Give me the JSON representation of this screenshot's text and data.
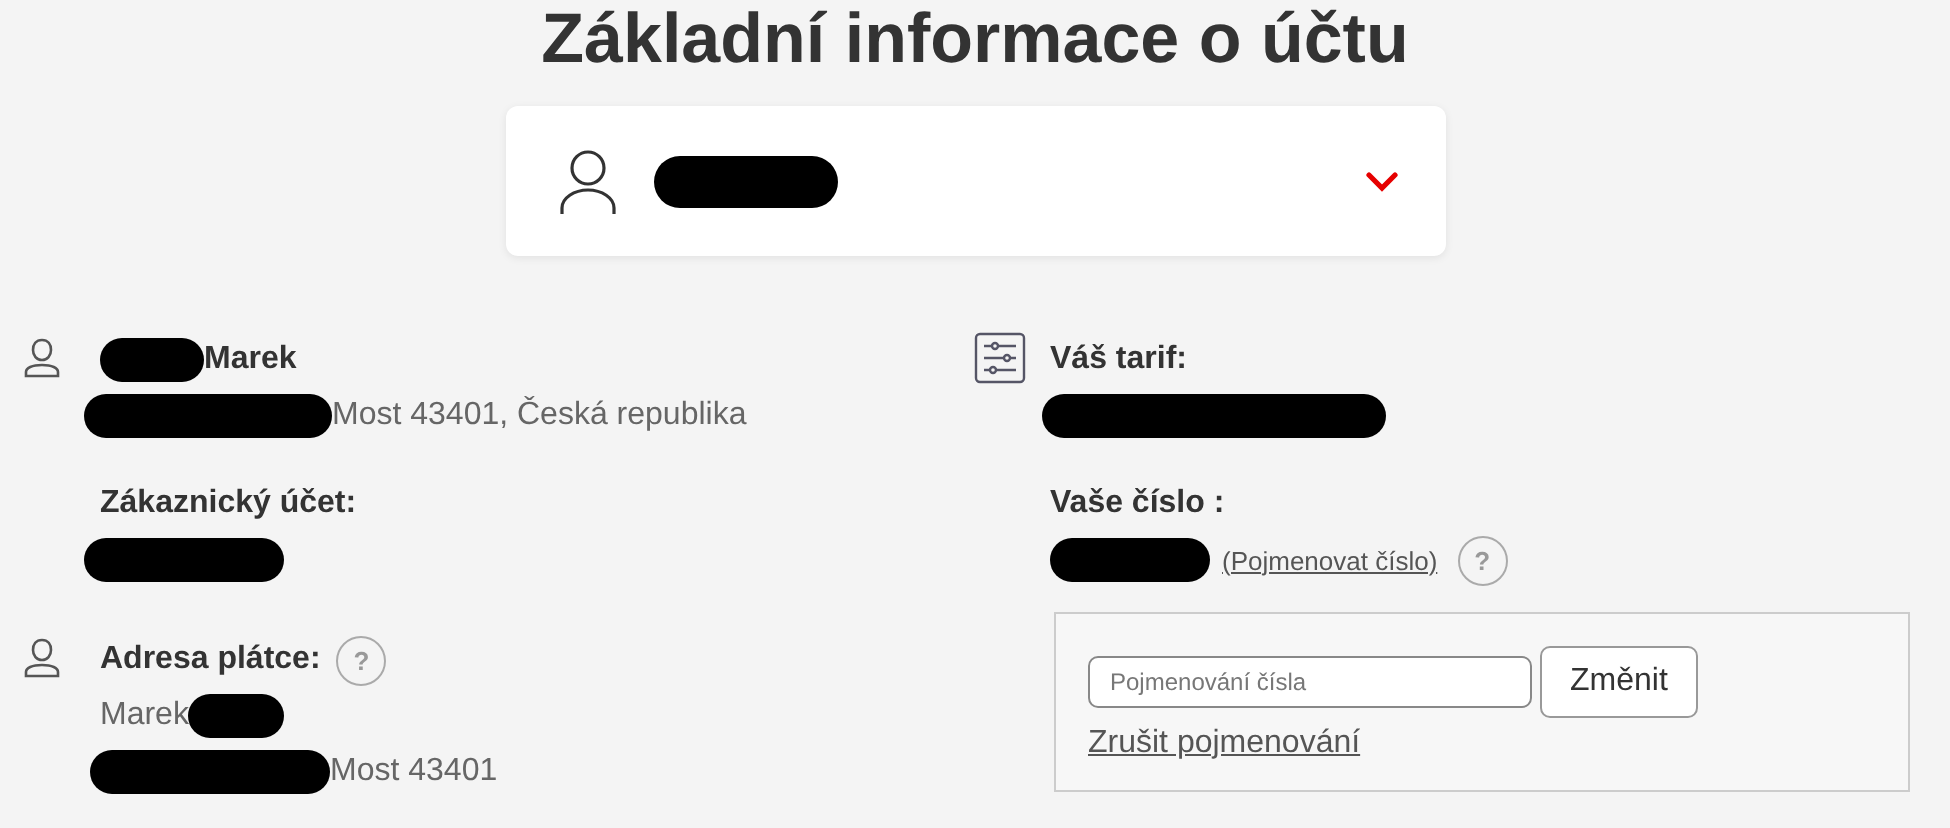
{
  "page": {
    "title": "Základní informace o účtu"
  },
  "account_selector": {
    "expanded": false
  },
  "customer": {
    "name": "Marek",
    "address": "Most 43401, Česká republika",
    "account_label": "Zákaznický účet:"
  },
  "payer": {
    "label": "Adresa plátce:",
    "help": "?",
    "name": "Marek",
    "address": "Most 43401"
  },
  "tariff": {
    "label": "Váš tarif:"
  },
  "number": {
    "label": "Vaše číslo :",
    "rename_link": "(Pojmenovat číslo)",
    "help": "?"
  },
  "rename_form": {
    "placeholder": "Pojmenování čísla",
    "submit": "Změnit",
    "cancel_link": "Zrušit pojmenování"
  }
}
